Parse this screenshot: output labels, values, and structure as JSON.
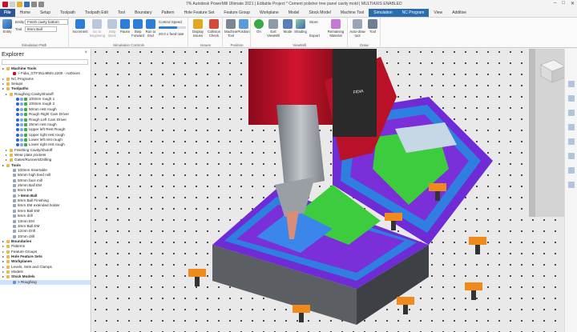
{
  "window": {
    "title": "7% Autodesk PowerMill Ultimate 2021  |  Editable Project * Cement polisher tree panel cavity mold |  MULTIAXIS ENABLED",
    "controls": [
      "–",
      "□",
      "✕"
    ]
  },
  "tabs": [
    "File",
    "Home",
    "Setup",
    "Toolpath",
    "Toolpath Edit",
    "Tool",
    "Boundary",
    "Pattern",
    "Hole Feature Set",
    "Feature Group",
    "Workplane",
    "Model",
    "Stock Model",
    "Machine Tool",
    "Simulation",
    "NC Program",
    "View",
    "Additive"
  ],
  "ribbon": {
    "entity_label": "Entity",
    "entity_value": "Finish cavity bottom",
    "tool_label": "Tool",
    "tool_value": "8mm Ball",
    "sim_path_group": "Simulation Path",
    "sim_controls_group": "Simulation Controls",
    "issues_group": "Issues",
    "position_group": "Position",
    "viewmill_group": "ViewMill",
    "draw_group": "Draw",
    "control_speed_label": "Control Speed",
    "feed_rate_text": "20.0 x feed rate",
    "buttons": {
      "entity": "Entity",
      "increment": "Increment",
      "go_beginning": "Go to Beginning",
      "step_back": "Step Back",
      "pause": "Pause",
      "step_forward": "Step Forward",
      "run_end": "Run to End",
      "display_issues": "Display Issues",
      "collision_check": "Collision Check",
      "machine_tool": "Machine Tool",
      "position": "Position",
      "on": "On",
      "exit_viewmill": "Exit ViewMill",
      "mode": "Mode",
      "shading": "Shading",
      "store": "Store",
      "export": "Export",
      "remaining_material": "Remaining Material",
      "auto_draw_tool": "Auto-draw tool",
      "tool": "Tool"
    }
  },
  "explorer": {
    "title": "Explorer",
    "search_placeholder": "",
    "rows": [
      {
        "label": "Machine Tools",
        "indent": 0,
        "bold": true,
        "icon": "folder"
      },
      {
        "label": "> Fidia_GTF35148M4.2200 - noDoors",
        "indent": 2,
        "icon": "machine"
      },
      {
        "label": "NC Programs",
        "indent": 0,
        "icon": "folder"
      },
      {
        "label": "Setups",
        "indent": 0,
        "icon": "folder"
      },
      {
        "label": "Toolpaths",
        "indent": 0,
        "bold": true,
        "icon": "folder"
      },
      {
        "label": "Roughing Cavity/shutoff",
        "indent": 1,
        "icon": "folder"
      },
      {
        "label": "100mm rough 1",
        "indent": 3,
        "check": true
      },
      {
        "label": "100mm rough 2",
        "indent": 3,
        "check": true
      },
      {
        "label": "50mm rest rough",
        "indent": 3,
        "check": true
      },
      {
        "label": "Rough Right Cam Driver",
        "indent": 3,
        "check": true
      },
      {
        "label": "Rough Left Cam Driver",
        "indent": 3,
        "check": true
      },
      {
        "label": "25mm rest rough",
        "indent": 3,
        "check": true
      },
      {
        "label": "Upper left Rest Rough",
        "indent": 3,
        "check": true
      },
      {
        "label": "Upper right rest rough",
        "indent": 3,
        "check": true
      },
      {
        "label": "Lower left rest rough",
        "indent": 3,
        "check": true
      },
      {
        "label": "Lower right rest rough",
        "indent": 3,
        "check": true
      },
      {
        "label": "Finishing Cavity/shutoff",
        "indent": 1,
        "icon": "folder"
      },
      {
        "label": "Wear plate pockets",
        "indent": 1,
        "icon": "folder"
      },
      {
        "label": "Gates/Runners/Drilling",
        "indent": 1,
        "icon": "folder"
      },
      {
        "label": "Tools",
        "indent": 0,
        "bold": true,
        "icon": "folder"
      },
      {
        "label": "100mm Insertable",
        "indent": 2,
        "icon": "tool"
      },
      {
        "label": "50mm high feed mill",
        "indent": 2,
        "icon": "tool"
      },
      {
        "label": "50mm face mill",
        "indent": 2,
        "icon": "tool"
      },
      {
        "label": "25mm Ball EM",
        "indent": 2,
        "icon": "tool"
      },
      {
        "label": "8mm EM",
        "indent": 2,
        "icon": "tool"
      },
      {
        "label": "> 8mm Ball",
        "indent": 2,
        "bold": true,
        "icon": "tool"
      },
      {
        "label": "8mm Ball Finishing",
        "indent": 2,
        "icon": "tool"
      },
      {
        "label": "8mm EM extended holder",
        "indent": 2,
        "icon": "tool"
      },
      {
        "label": "6mm Ball EM",
        "indent": 2,
        "icon": "tool"
      },
      {
        "label": "6mm drill",
        "indent": 2,
        "icon": "tool"
      },
      {
        "label": "13mm EM",
        "indent": 2,
        "icon": "tool"
      },
      {
        "label": "3mm Ball EM",
        "indent": 2,
        "icon": "tool"
      },
      {
        "label": "12mm Drill",
        "indent": 2,
        "icon": "tool"
      },
      {
        "label": "10mm drill",
        "indent": 2,
        "icon": "tool"
      },
      {
        "label": "Boundaries",
        "indent": 0,
        "bold": true,
        "icon": "folder"
      },
      {
        "label": "Patterns",
        "indent": 0,
        "icon": "folder"
      },
      {
        "label": "Feature Groups",
        "indent": 0,
        "icon": "folder"
      },
      {
        "label": "Hole Feature Sets",
        "indent": 0,
        "bold": true,
        "icon": "folder"
      },
      {
        "label": "Workplanes",
        "indent": 0,
        "bold": true,
        "icon": "folder"
      },
      {
        "label": "Levels, Sets and Clamps",
        "indent": 0,
        "icon": "folder"
      },
      {
        "label": "Models",
        "indent": 0,
        "icon": "folder"
      },
      {
        "label": "Stock Models",
        "indent": 0,
        "bold": true,
        "icon": "folder"
      },
      {
        "label": "> Roughing",
        "indent": 2,
        "icon": "stock",
        "selected": true
      }
    ]
  },
  "machine_logo": "FIDIA",
  "colors": {
    "accent": "#2b6cb0",
    "file_tab": "#2b579a",
    "cavity_purple": "#7a2fd9",
    "cavity_green": "#3dcc3d",
    "cavity_blue": "#2f7fe0",
    "machine_red": "#c8102e",
    "steel": "#555a60",
    "clamp_orange": "#f08a1c"
  }
}
